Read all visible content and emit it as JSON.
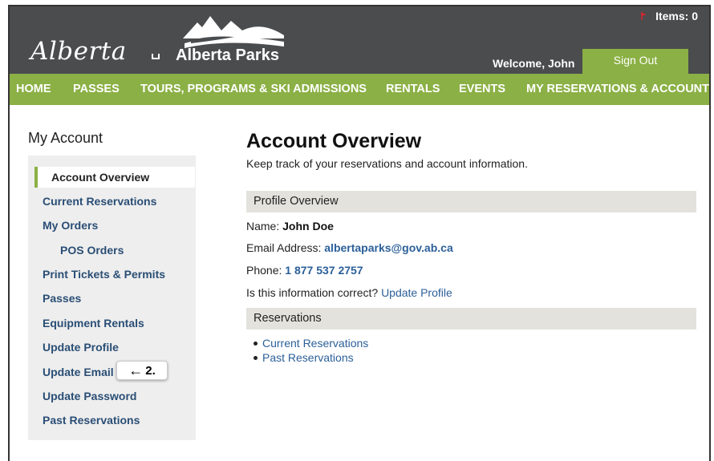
{
  "header": {
    "brand_script": "Alberta",
    "brand_parks": "Alberta Parks",
    "cart_label": "Items: 0",
    "welcome": "Welcome, John",
    "signout": "Sign Out"
  },
  "nav": {
    "items": [
      {
        "label": "HOME"
      },
      {
        "label": "PASSES"
      },
      {
        "label": "TOURS, PROGRAMS & SKI ADMISSIONS"
      },
      {
        "label": "RENTALS"
      },
      {
        "label": "EVENTS"
      },
      {
        "label": "MY RESERVATIONS & ACCOUNT"
      }
    ]
  },
  "sidebar": {
    "title": "My Account",
    "active": "Account Overview",
    "items": [
      {
        "label": "Current Reservations"
      },
      {
        "label": "My Orders"
      },
      {
        "label": "POS Orders"
      },
      {
        "label": "Print Tickets & Permits"
      },
      {
        "label": "Passes"
      },
      {
        "label": "Equipment Rentals"
      },
      {
        "label": "Update Profile"
      },
      {
        "label": "Update Email"
      },
      {
        "label": "Update Password"
      },
      {
        "label": "Past Reservations"
      }
    ],
    "callout": {
      "arrow": "←",
      "label": "2."
    }
  },
  "main": {
    "title": "Account Overview",
    "subtitle": "Keep track of your reservations and account information.",
    "profile_header": "Profile Overview",
    "name_label": "Name: ",
    "name_value": "John Doe",
    "email_label": "Email Address: ",
    "email_value": "albertaparks@gov.ab.ca",
    "phone_label": "Phone: ",
    "phone_value": "1 877 537 2757",
    "correct_label": "Is this information correct? ",
    "update_profile_link": "Update Profile",
    "reservations_header": "Reservations",
    "reservation_links": [
      {
        "label": "Current Reservations"
      },
      {
        "label": "Past Reservations"
      }
    ]
  },
  "colors": {
    "header_bg": "#4a4c4e",
    "accent_green": "#8bb045",
    "link_blue": "#2b5f99",
    "sidebar_link": "#2a4e75",
    "section_bar": "#e3e2dc",
    "cart_flag": "#d9252a"
  },
  "icons": {
    "logo": "mountain-logo-icon",
    "cart": "red-flag-icon",
    "callout": "left-arrow-icon"
  }
}
